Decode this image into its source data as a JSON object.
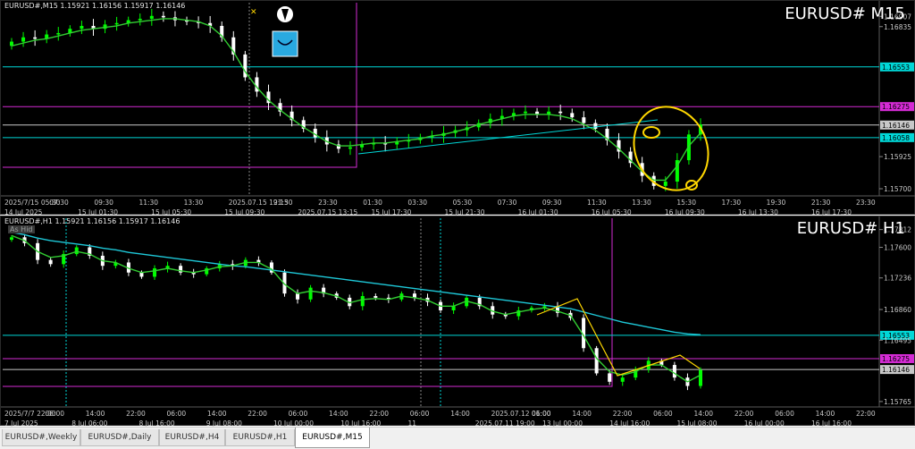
{
  "charts": [
    {
      "id": "m15",
      "symbol_line": "EURUSD#,M15  1.15921 1.16156 1.15917 1.16146",
      "big_label": "EURUSD# M15",
      "price_labels": [
        "1.16907",
        "1.16835",
        "1.16553",
        "1.16275",
        "1.16146",
        "1.16058",
        "1.15925",
        "1.15700"
      ],
      "hlines": [
        {
          "price": "1.16553",
          "color": "#00d7d7"
        },
        {
          "price": "1.16275",
          "color": "#d42bd4"
        },
        {
          "price": "1.16146",
          "color": "#c8c8c8"
        },
        {
          "price": "1.16058",
          "color": "#00d7d7"
        }
      ],
      "time_labels": [
        "2025/7/15 05:30",
        "07:30",
        "09:30",
        "11:30",
        "13:30",
        "2025.07.15 19:15",
        "21:30",
        "23:30",
        "01:30",
        "03:30",
        "05:30",
        "07:30",
        "09:30",
        "11:30",
        "13:30",
        "15:30",
        "17:30",
        "19:30",
        "21:30",
        "23:30"
      ],
      "time_labels_2": [
        "14 Jul 2025",
        "15 Jul 01:30",
        "15 Jul 05:30",
        "15 Jul 09:30",
        "2025.07.15 13:15",
        "15 Jul 17:30",
        "15 Jul 21:30",
        "16 Jul 01:30",
        "16 Jul 05:30",
        "16 Jul 09:30",
        "16 Jul 13:30",
        "16 Jul 17:30"
      ]
    },
    {
      "id": "h1",
      "symbol_line": "EURUSD#,H1  1.15921 1.16156 1.15917 1.16146",
      "big_label": "EURUSD# H1",
      "as_hide": "As Hid",
      "price_labels": [
        "1.17812",
        "1.17600",
        "1.17236",
        "1.16860",
        "1.16553",
        "1.16495",
        "1.16275",
        "1.16146",
        "1.15765"
      ],
      "hlines": [
        {
          "price": "1.16553",
          "color": "#00d7d7"
        },
        {
          "price": "1.16275",
          "color": "#d42bd4"
        },
        {
          "price": "1.16146",
          "color": "#c8c8c8"
        }
      ],
      "time_labels": [
        "2025/7/7 22:00",
        "06:00",
        "14:00",
        "22:00",
        "06:00",
        "14:00",
        "22:00",
        "06:00",
        "14:00",
        "22:00",
        "06:00",
        "14:00",
        "2025.07.12 01:00",
        "06:00",
        "14:00",
        "22:00",
        "06:00",
        "14:00",
        "22:00",
        "06:00",
        "14:00",
        "22:00"
      ],
      "time_labels_2": [
        "7 Jul 2025",
        "8 Jul 06:00",
        "8 Jul 16:00",
        "9 Jul 08:00",
        "10 Jul 00:00",
        "10 Jul 16:00",
        "11",
        "2025.07.11 19:00",
        "13 Jul 00:00",
        "14 Jul 16:00",
        "15 Jul 08:00",
        "16 Jul 00:00",
        "16 Jul 16:00"
      ]
    }
  ],
  "tabs": [
    "EURUSD#,Weekly",
    "EURUSD#,Daily",
    "EURUSD#,H4",
    "EURUSD#,H1",
    "EURUSD#,M15"
  ],
  "active_tab": "EURUSD#,M15",
  "colors": {
    "background": "#000000",
    "bull": "#00ff00",
    "bear": "#ffffff",
    "ma_fast": "#32cd32",
    "ma_slow": "#1ec8d8",
    "fib": "#ffd700",
    "magenta": "#d42bd4",
    "cyan": "#00d7d7"
  },
  "chart_data": [
    {
      "type": "candlestick",
      "title": "EURUSD# M15",
      "ylim": [
        1.1565,
        1.1694
      ],
      "close_series": [
        1.1673,
        1.1676,
        1.1675,
        1.1678,
        1.1679,
        1.1682,
        1.1684,
        1.1682,
        1.1685,
        1.1686,
        1.1688,
        1.1689,
        1.1691,
        1.169,
        1.1688,
        1.1687,
        1.1686,
        1.1684,
        1.1676,
        1.1664,
        1.1648,
        1.1638,
        1.163,
        1.1624,
        1.1618,
        1.1612,
        1.1606,
        1.1601,
        1.1598,
        1.1599,
        1.1601,
        1.1602,
        1.1601,
        1.1603,
        1.1604,
        1.1606,
        1.1607,
        1.1609,
        1.1611,
        1.1613,
        1.1616,
        1.1619,
        1.1621,
        1.1623,
        1.1624,
        1.1622,
        1.1624,
        1.1623,
        1.162,
        1.1616,
        1.1612,
        1.1604,
        1.1596,
        1.1588,
        1.1579,
        1.1572,
        1.1575,
        1.159,
        1.1608,
        1.1615
      ],
      "ma_fast": [
        1.167,
        1.1672,
        1.1674,
        1.1675,
        1.1677,
        1.1679,
        1.1681,
        1.1682,
        1.1683,
        1.1684,
        1.1686,
        1.1687,
        1.1688,
        1.1689,
        1.1689,
        1.1688,
        1.1687,
        1.1684,
        1.1677,
        1.1666,
        1.1652,
        1.1641,
        1.1632,
        1.1625,
        1.1619,
        1.1613,
        1.1608,
        1.1603,
        1.16,
        1.16,
        1.1601,
        1.1602,
        1.1602,
        1.1603,
        1.1604,
        1.1605,
        1.1607,
        1.1608,
        1.161,
        1.1612,
        1.1615,
        1.1617,
        1.1619,
        1.1621,
        1.1622,
        1.1622,
        1.1622,
        1.1621,
        1.1619,
        1.1615,
        1.1611,
        1.1605,
        1.1598,
        1.159,
        1.1582,
        1.1576,
        1.1576,
        1.1586,
        1.16,
        1.1609
      ],
      "hline_values": [
        1.16553,
        1.16275,
        1.16146,
        1.16058
      ]
    },
    {
      "type": "candlestick",
      "title": "EURUSD# H1",
      "ylim": [
        1.157,
        1.1784
      ],
      "close_series": [
        1.1772,
        1.1765,
        1.1745,
        1.174,
        1.1752,
        1.176,
        1.175,
        1.1738,
        1.1742,
        1.173,
        1.1725,
        1.1735,
        1.1738,
        1.173,
        1.1728,
        1.1735,
        1.174,
        1.1738,
        1.1745,
        1.1742,
        1.173,
        1.1705,
        1.1698,
        1.1712,
        1.1705,
        1.17,
        1.169,
        1.1702,
        1.17,
        1.1698,
        1.1705,
        1.17,
        1.1695,
        1.1685,
        1.169,
        1.17,
        1.169,
        1.168,
        1.1678,
        1.1685,
        1.1688,
        1.169,
        1.1682,
        1.1676,
        1.164,
        1.161,
        1.16,
        1.1605,
        1.1615,
        1.1625,
        1.162,
        1.1605,
        1.1595,
        1.1614
      ],
      "ma_fast": [
        1.1774,
        1.1768,
        1.1755,
        1.1748,
        1.175,
        1.1755,
        1.1752,
        1.1744,
        1.1742,
        1.1735,
        1.173,
        1.1732,
        1.1735,
        1.1732,
        1.173,
        1.1733,
        1.1737,
        1.1738,
        1.1742,
        1.1742,
        1.1734,
        1.1716,
        1.1705,
        1.1708,
        1.1706,
        1.1702,
        1.1694,
        1.1698,
        1.1699,
        1.1698,
        1.1702,
        1.17,
        1.1697,
        1.169,
        1.169,
        1.1696,
        1.1692,
        1.1684,
        1.168,
        1.1683,
        1.1686,
        1.1688,
        1.1684,
        1.1679,
        1.1655,
        1.1628,
        1.1612,
        1.1608,
        1.1612,
        1.162,
        1.162,
        1.161,
        1.16,
        1.1608
      ],
      "ma_slow": [
        1.1778,
        1.1775,
        1.1771,
        1.1768,
        1.1766,
        1.1764,
        1.1762,
        1.1759,
        1.1757,
        1.1754,
        1.1752,
        1.175,
        1.1748,
        1.1746,
        1.1744,
        1.1742,
        1.174,
        1.1738,
        1.1737,
        1.1735,
        1.1733,
        1.1731,
        1.1729,
        1.1727,
        1.1725,
        1.1723,
        1.1721,
        1.1719,
        1.1717,
        1.1715,
        1.1713,
        1.1711,
        1.1709,
        1.1707,
        1.1705,
        1.1703,
        1.1701,
        1.1699,
        1.1697,
        1.1695,
        1.1693,
        1.1691,
        1.1689,
        1.1687,
        1.1683,
        1.1679,
        1.1675,
        1.1671,
        1.1668,
        1.1665,
        1.1662,
        1.1659,
        1.1657,
        1.1656
      ],
      "hline_values": [
        1.16553,
        1.16275,
        1.16146
      ]
    }
  ]
}
